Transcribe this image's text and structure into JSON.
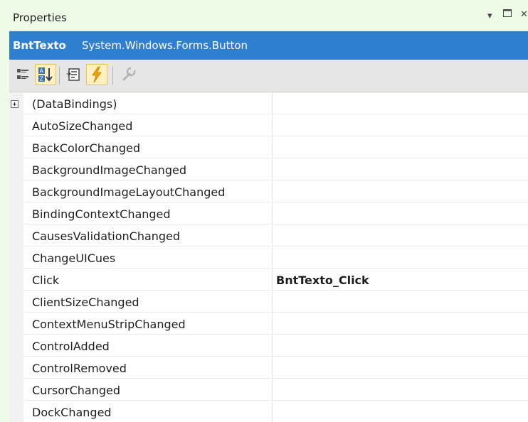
{
  "window": {
    "title": "Properties",
    "controls": [
      "dropdown-arrow",
      "maximize",
      "close"
    ]
  },
  "header": {
    "object_name": "BntTexto",
    "object_type": "System.Windows.Forms.Button"
  },
  "toolbar": {
    "buttons": [
      {
        "icon": "categorized-icon",
        "active": false
      },
      {
        "icon": "alphabetical-icon",
        "active": true
      },
      {
        "icon": "properties-icon",
        "active": false
      },
      {
        "icon": "events-lightning-icon",
        "active": true
      },
      {
        "icon": "property-pages-wrench-icon",
        "active": false,
        "disabled": true
      }
    ]
  },
  "events": [
    {
      "name": "(DataBindings)",
      "value": "",
      "expandable": true
    },
    {
      "name": "AutoSizeChanged",
      "value": ""
    },
    {
      "name": "BackColorChanged",
      "value": ""
    },
    {
      "name": "BackgroundImageChanged",
      "value": ""
    },
    {
      "name": "BackgroundImageLayoutChanged",
      "value": ""
    },
    {
      "name": "BindingContextChanged",
      "value": ""
    },
    {
      "name": "CausesValidationChanged",
      "value": ""
    },
    {
      "name": "ChangeUICues",
      "value": ""
    },
    {
      "name": "Click",
      "value": "BntTexto_Click"
    },
    {
      "name": "ClientSizeChanged",
      "value": ""
    },
    {
      "name": "ContextMenuStripChanged",
      "value": ""
    },
    {
      "name": "ControlAdded",
      "value": ""
    },
    {
      "name": "ControlRemoved",
      "value": ""
    },
    {
      "name": "CursorChanged",
      "value": ""
    },
    {
      "name": "DockChanged",
      "value": ""
    }
  ],
  "colors": {
    "background": "#eefbe6",
    "header_blue": "#2f7fd0",
    "active_button": "#fff0be",
    "lightning": "#f0a30a"
  }
}
